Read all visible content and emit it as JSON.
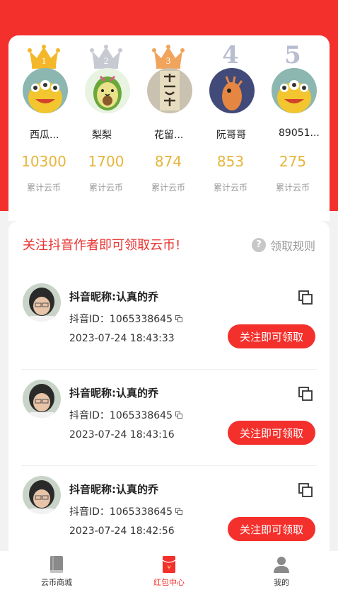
{
  "colors": {
    "brand_red": "#f4302c",
    "coin_gold": "#e6b53a",
    "gold_crown": "#f5b72a",
    "silver_crown": "#c7cad3",
    "bronze_crown": "#f0a45c"
  },
  "leaderboard": [
    {
      "rank": "1",
      "name": "西瓜...",
      "coins": "10300",
      "coins_label": "累计云币",
      "avatar_icon": "yellow-monster-avatar"
    },
    {
      "rank": "2",
      "name": "梨梨",
      "coins": "1700",
      "coins_label": "累计云币",
      "avatar_icon": "avocado-avatar"
    },
    {
      "rank": "3",
      "name": "花留...",
      "coins": "874",
      "coins_label": "累计云币",
      "avatar_icon": "calligraphy-avatar"
    },
    {
      "rank": "4",
      "name": "阮哥哥",
      "coins": "853",
      "coins_label": "累计云币",
      "avatar_icon": "orange-bird-avatar"
    },
    {
      "rank": "5",
      "name": "89051...",
      "coins": "275",
      "coins_label": "累计云币",
      "avatar_icon": "yellow-monster-avatar"
    }
  ],
  "follow_section": {
    "title": "关注抖音作者即可领取云币!",
    "rules_label": "领取规则",
    "entries": [
      {
        "nickname": "抖音昵称:认真的乔",
        "douyin_id": "抖音ID：1065338645",
        "time": "2023-07-24 18:43:33",
        "button": "关注即可领取"
      },
      {
        "nickname": "抖音昵称:认真的乔",
        "douyin_id": "抖音ID：1065338645",
        "time": "2023-07-24 18:43:16",
        "button": "关注即可领取"
      },
      {
        "nickname": "抖音昵称:认真的乔",
        "douyin_id": "抖音ID：1065338645",
        "time": "2023-07-24 18:42:56",
        "button": "关注即可领取"
      }
    ]
  },
  "bottom_nav": [
    {
      "label": "云币商城",
      "icon": "book-icon",
      "active": false
    },
    {
      "label": "红包中心",
      "icon": "red-envelope-icon",
      "active": true
    },
    {
      "label": "我的",
      "icon": "person-icon",
      "active": false
    }
  ]
}
